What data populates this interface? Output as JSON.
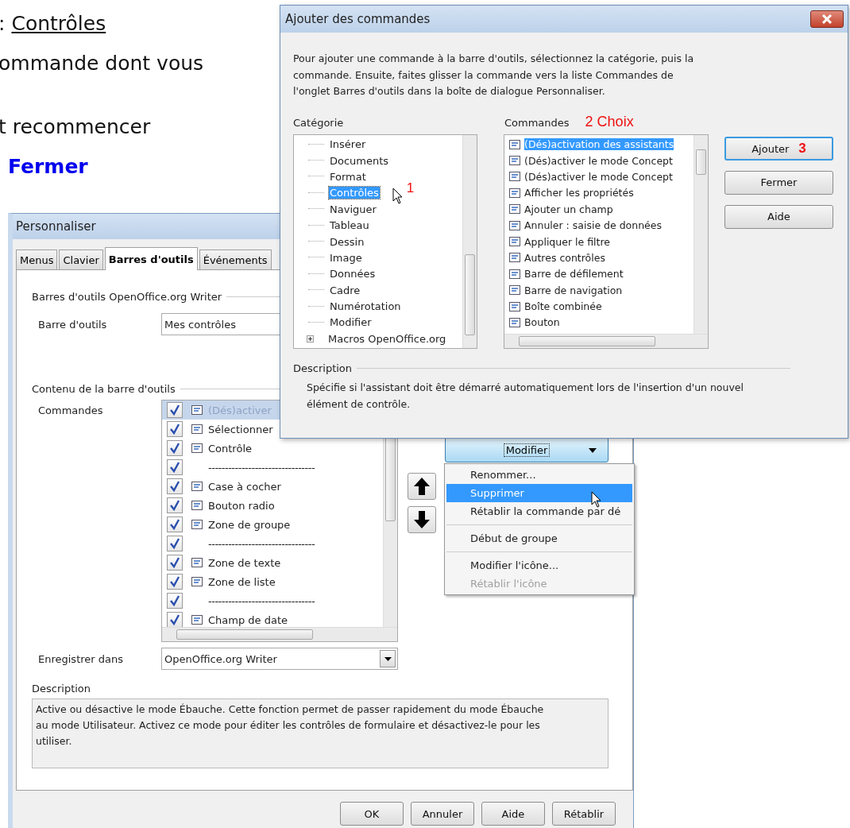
{
  "document_text": [
    {
      "kind": "link",
      "prefix": ":",
      "link": "Contrôles"
    },
    {
      "kind": "plain",
      "text": "ommande dont vous"
    },
    {
      "kind": "plain",
      "text": "t recommencer"
    },
    {
      "kind": "emphasis",
      "text": "Fermer"
    }
  ],
  "customize_dialog": {
    "title": "Personnaliser",
    "tabs": [
      {
        "label": "Menus",
        "selected": false
      },
      {
        "label": "Clavier",
        "selected": false
      },
      {
        "label": "Barres d'outils",
        "selected": true
      },
      {
        "label": "Événements",
        "selected": false
      }
    ],
    "toolbars_legend": "Barres d'outils OpenOffice.org Writer",
    "toolbar_label": "Barre d'outils",
    "toolbar_value": "Mes contrôles",
    "content_legend": "Contenu de la barre d'outils",
    "commands_label": "Commandes",
    "commands": [
      {
        "kind": "command",
        "label": "(Dés)activer",
        "checked": true,
        "selected": true
      },
      {
        "kind": "command",
        "label": "Sélectionner",
        "checked": true,
        "selected": false
      },
      {
        "kind": "command",
        "label": "Contrôle",
        "checked": true,
        "selected": false
      },
      {
        "kind": "separator",
        "label": "--------------------------------",
        "checked": true,
        "selected": false
      },
      {
        "kind": "command",
        "label": "Case à cocher",
        "checked": true,
        "selected": false
      },
      {
        "kind": "command",
        "label": "Bouton radio",
        "checked": true,
        "selected": false
      },
      {
        "kind": "command",
        "label": "Zone de groupe",
        "checked": true,
        "selected": false
      },
      {
        "kind": "separator",
        "label": "--------------------------------",
        "checked": true,
        "selected": false
      },
      {
        "kind": "command",
        "label": "Zone de texte",
        "checked": true,
        "selected": false
      },
      {
        "kind": "command",
        "label": "Zone de liste",
        "checked": true,
        "selected": false
      },
      {
        "kind": "separator",
        "label": "--------------------------------",
        "checked": true,
        "selected": false
      },
      {
        "kind": "command",
        "label": "Champ de date",
        "checked": true,
        "selected": false
      }
    ],
    "modify_button": "Modifier",
    "save_in_label": "Enregistrer dans",
    "save_in_value": "OpenOffice.org Writer",
    "description_label": "Description",
    "description_text": "Active ou désactive le mode Ébauche. Cette fonction permet de passer rapidement du mode Ébauche au mode Utilisateur. Activez ce mode pour éditer les contrôles de formulaire et désactivez-le pour les utiliser.",
    "buttons": [
      "OK",
      "Annuler",
      "Aide",
      "Rétablir"
    ]
  },
  "modify_menu": [
    {
      "kind": "item",
      "label": "Renommer...",
      "selected": false,
      "disabled": false
    },
    {
      "kind": "item",
      "label": "Supprimer",
      "selected": true,
      "disabled": false
    },
    {
      "kind": "item",
      "label": "Rétablir la commande par dé",
      "selected": false,
      "disabled": false
    },
    {
      "kind": "divider"
    },
    {
      "kind": "item",
      "label": "Début de groupe",
      "selected": false,
      "disabled": false
    },
    {
      "kind": "divider"
    },
    {
      "kind": "item",
      "label": "Modifier l'icône...",
      "selected": false,
      "disabled": false
    },
    {
      "kind": "item",
      "label": "Rétablir l'icône",
      "selected": false,
      "disabled": true
    }
  ],
  "add_dialog": {
    "title": "Ajouter des commandes",
    "intro": "Pour ajouter une commande à la barre d'outils, sélectionnez la catégorie, puis la commande. Ensuite, faites glisser la commande vers la liste Commandes de l'onglet Barres d'outils dans la boîte de dialogue Personnaliser.",
    "category_label": "Catégorie",
    "categories": [
      {
        "label": "Insérer",
        "selected": false
      },
      {
        "label": "Documents",
        "selected": false
      },
      {
        "label": "Format",
        "selected": false
      },
      {
        "label": "Contrôles",
        "selected": true,
        "annotation": "1"
      },
      {
        "label": "Naviguer",
        "selected": false
      },
      {
        "label": "Tableau",
        "selected": false
      },
      {
        "label": "Dessin",
        "selected": false
      },
      {
        "label": "Image",
        "selected": false
      },
      {
        "label": "Données",
        "selected": false
      },
      {
        "label": "Cadre",
        "selected": false
      },
      {
        "label": "Numérotation",
        "selected": false
      },
      {
        "label": "Modifier",
        "selected": false
      },
      {
        "label": "Macros OpenOffice.org",
        "selected": false,
        "expanded": false
      }
    ],
    "commands_label": "Commandes",
    "commands_annotation": "2 Choix",
    "commands": [
      {
        "label": "(Dés)activation des assistants",
        "selected": true
      },
      {
        "label": "(Dés)activer le mode Concept",
        "selected": false
      },
      {
        "label": "(Dés)activer le mode Concept",
        "selected": false
      },
      {
        "label": "Afficher les propriétés",
        "selected": false
      },
      {
        "label": "Ajouter un champ",
        "selected": false
      },
      {
        "label": "Annuler : saisie de données",
        "selected": false
      },
      {
        "label": "Appliquer le filtre",
        "selected": false
      },
      {
        "label": "Autres contrôles",
        "selected": false
      },
      {
        "label": "Barre de défilement",
        "selected": false
      },
      {
        "label": "Barre de navigation",
        "selected": false
      },
      {
        "label": "Boîte combinée",
        "selected": false
      },
      {
        "label": "Bouton",
        "selected": false
      }
    ],
    "buttons": [
      {
        "label": "Ajouter",
        "default": true,
        "annotation": "3"
      },
      {
        "label": "Fermer",
        "default": false
      },
      {
        "label": "Aide",
        "default": false
      }
    ],
    "description_legend": "Description",
    "description_text": "Spécifie si l'assistant doit être démarré automatiquement lors de l'insertion d'un nouvel élément de contrôle."
  }
}
